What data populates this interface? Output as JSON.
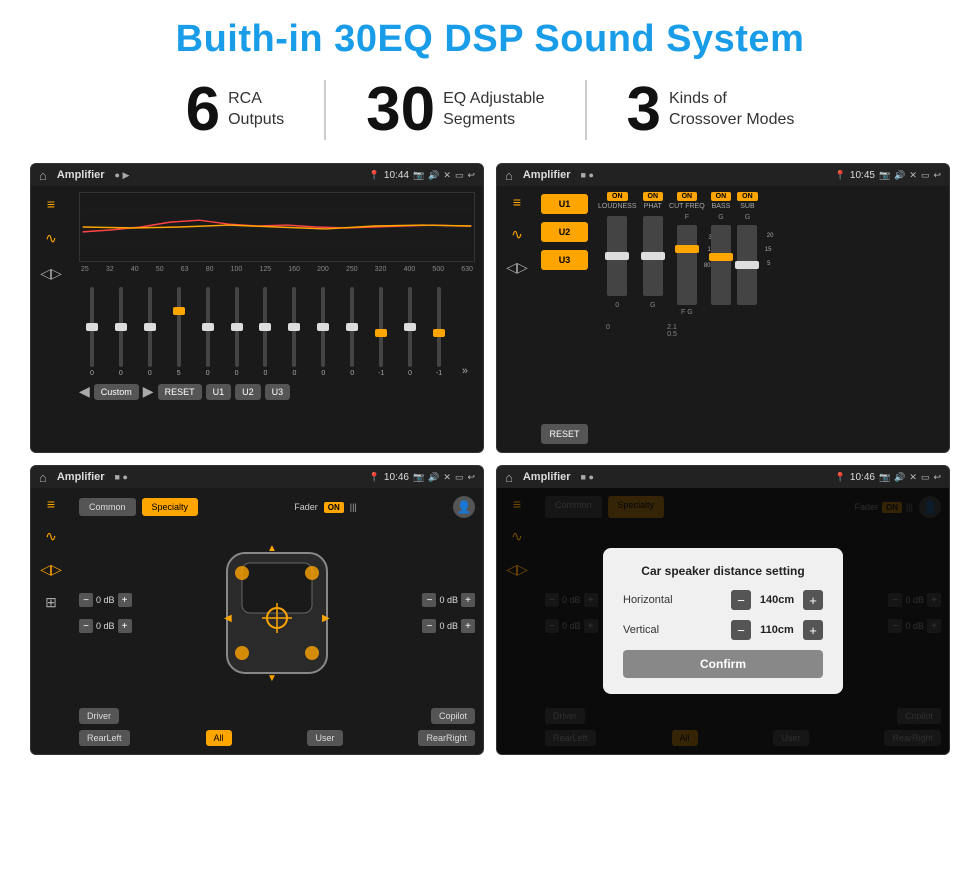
{
  "page": {
    "title": "Buith-in 30EQ DSP Sound System",
    "stats": [
      {
        "number": "6",
        "label": "RCA\nOutputs"
      },
      {
        "number": "30",
        "label": "EQ Adjustable\nSegments"
      },
      {
        "number": "3",
        "label": "Kinds of\nCrossover Modes"
      }
    ]
  },
  "screens": {
    "screen1": {
      "status_bar": {
        "title": "Amplifier",
        "time": "10:44"
      },
      "freq_labels": [
        "25",
        "32",
        "40",
        "50",
        "63",
        "80",
        "100",
        "125",
        "160",
        "200",
        "250",
        "320",
        "400",
        "500",
        "630"
      ],
      "slider_values": [
        "0",
        "0",
        "0",
        "5",
        "0",
        "0",
        "0",
        "0",
        "0",
        "0",
        "-1",
        "0",
        "-1"
      ],
      "buttons": [
        "Custom",
        "RESET",
        "U1",
        "U2",
        "U3"
      ]
    },
    "screen2": {
      "status_bar": {
        "title": "Amplifier",
        "time": "10:45"
      },
      "presets": [
        "U1",
        "U2",
        "U3"
      ],
      "knobs": [
        {
          "label": "LOUDNESS",
          "on": true
        },
        {
          "label": "PHAT",
          "on": true
        },
        {
          "label": "CUT FREQ",
          "on": true
        },
        {
          "label": "BASS",
          "on": true
        },
        {
          "label": "SUB",
          "on": true
        }
      ],
      "reset_label": "RESET"
    },
    "screen3": {
      "status_bar": {
        "title": "Amplifier",
        "time": "10:46"
      },
      "tabs": [
        "Common",
        "Specialty"
      ],
      "active_tab": "Specialty",
      "fader_label": "Fader",
      "fader_on": "ON",
      "vol_controls": [
        {
          "label": "0 dB",
          "side": "left"
        },
        {
          "label": "0 dB",
          "side": "left"
        },
        {
          "label": "0 dB",
          "side": "right"
        },
        {
          "label": "0 dB",
          "side": "right"
        }
      ],
      "bottom_buttons": [
        "Driver",
        "All",
        "User",
        "RearLeft",
        "RearRight",
        "Copilot"
      ]
    },
    "screen4": {
      "status_bar": {
        "title": "Amplifier",
        "time": "10:46"
      },
      "tabs": [
        "Common",
        "Specialty"
      ],
      "dialog": {
        "title": "Car speaker distance setting",
        "horizontal_label": "Horizontal",
        "horizontal_value": "140cm",
        "vertical_label": "Vertical",
        "vertical_value": "110cm",
        "confirm_label": "Confirm"
      }
    }
  },
  "icons": {
    "home": "⌂",
    "location": "📍",
    "speaker": "🔊",
    "back": "↩",
    "close": "✕",
    "window": "▭",
    "equalizer": "≡",
    "waveform": "∿",
    "speaker_small": "◁",
    "expand": "⊞",
    "minus": "−",
    "plus": "+"
  }
}
